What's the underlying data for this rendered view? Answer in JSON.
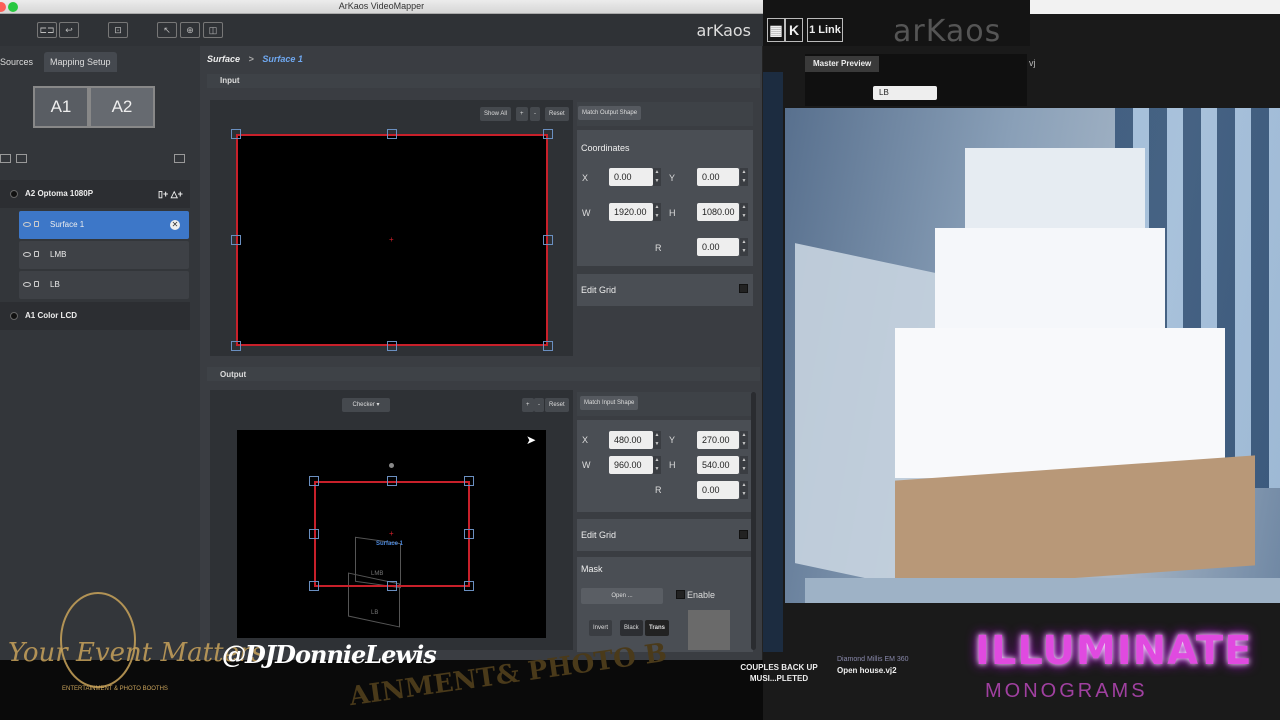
{
  "window": {
    "title": "ArKaos VideoMapper",
    "logo": "arKaos"
  },
  "left_panel": {
    "tabs": [
      "Sources",
      "Mapping Setup"
    ],
    "screens": [
      "A1",
      "A2"
    ],
    "devices": [
      {
        "label": "A2  Optoma 1080P",
        "surfaces": [
          "Surface 1",
          "LMB",
          "LB"
        ]
      },
      {
        "label": "A1  Color LCD",
        "surfaces": []
      }
    ]
  },
  "breadcrumb": {
    "root": "Surface",
    "sep": ">",
    "current": "Surface 1"
  },
  "input": {
    "label": "Input",
    "buttons": {
      "show_all": "Show All",
      "plus": "+",
      "minus": "-",
      "reset": "Reset"
    },
    "match": "Match Output Shape",
    "coordinates_title": "Coordinates",
    "x_label": "X",
    "x": "0.00",
    "y_label": "Y",
    "y": "0.00",
    "w_label": "W",
    "w": "1920.00",
    "h_label": "H",
    "h": "1080.00",
    "r_label": "R",
    "r": "0.00",
    "edit_grid": "Edit Grid"
  },
  "output": {
    "label": "Output",
    "checker": "Checker",
    "buttons": {
      "plus": "+",
      "minus": "-",
      "reset": "Reset"
    },
    "match": "Match Input Shape",
    "surface_label": "Surface 1",
    "lmb_label": "LMB",
    "lb_label": "LB",
    "x_label": "X",
    "x": "480.00",
    "y_label": "Y",
    "y": "270.00",
    "w_label": "W",
    "w": "960.00",
    "h_label": "H",
    "h": "540.00",
    "r_label": "R",
    "r": "0.00",
    "edit_grid": "Edit Grid",
    "mask_title": "Mask",
    "open": "Open ...",
    "enable": "Enable",
    "invert": "Invert",
    "black": "Black",
    "trans": "Trans"
  },
  "background_app": {
    "toolbar_k": "K",
    "toolbar_link": "1 Link",
    "logo": "arKaos",
    "preview_tab": "Master Preview",
    "preview_select": "LB",
    "vj": "vj",
    "clip1": "COUPLES BACK UP MUSI...PLETED",
    "clip2": "Open house.vj2",
    "clip3": "Diamond Millis EM 360"
  },
  "watermarks": {
    "brand": "Your Event Matters",
    "brand_sub": "ENTERTAINMENT & PHOTO BOOTHS",
    "handle": "@DJDonnieLewis",
    "ainment": "AINMENT& PHOTO B",
    "illuminate": "ILLUMINATE",
    "monograms": "MONOGRAMS"
  },
  "colors": {
    "accent": "#3d77c8",
    "outline": "#d0202a",
    "handle": "#6a8fc0"
  }
}
